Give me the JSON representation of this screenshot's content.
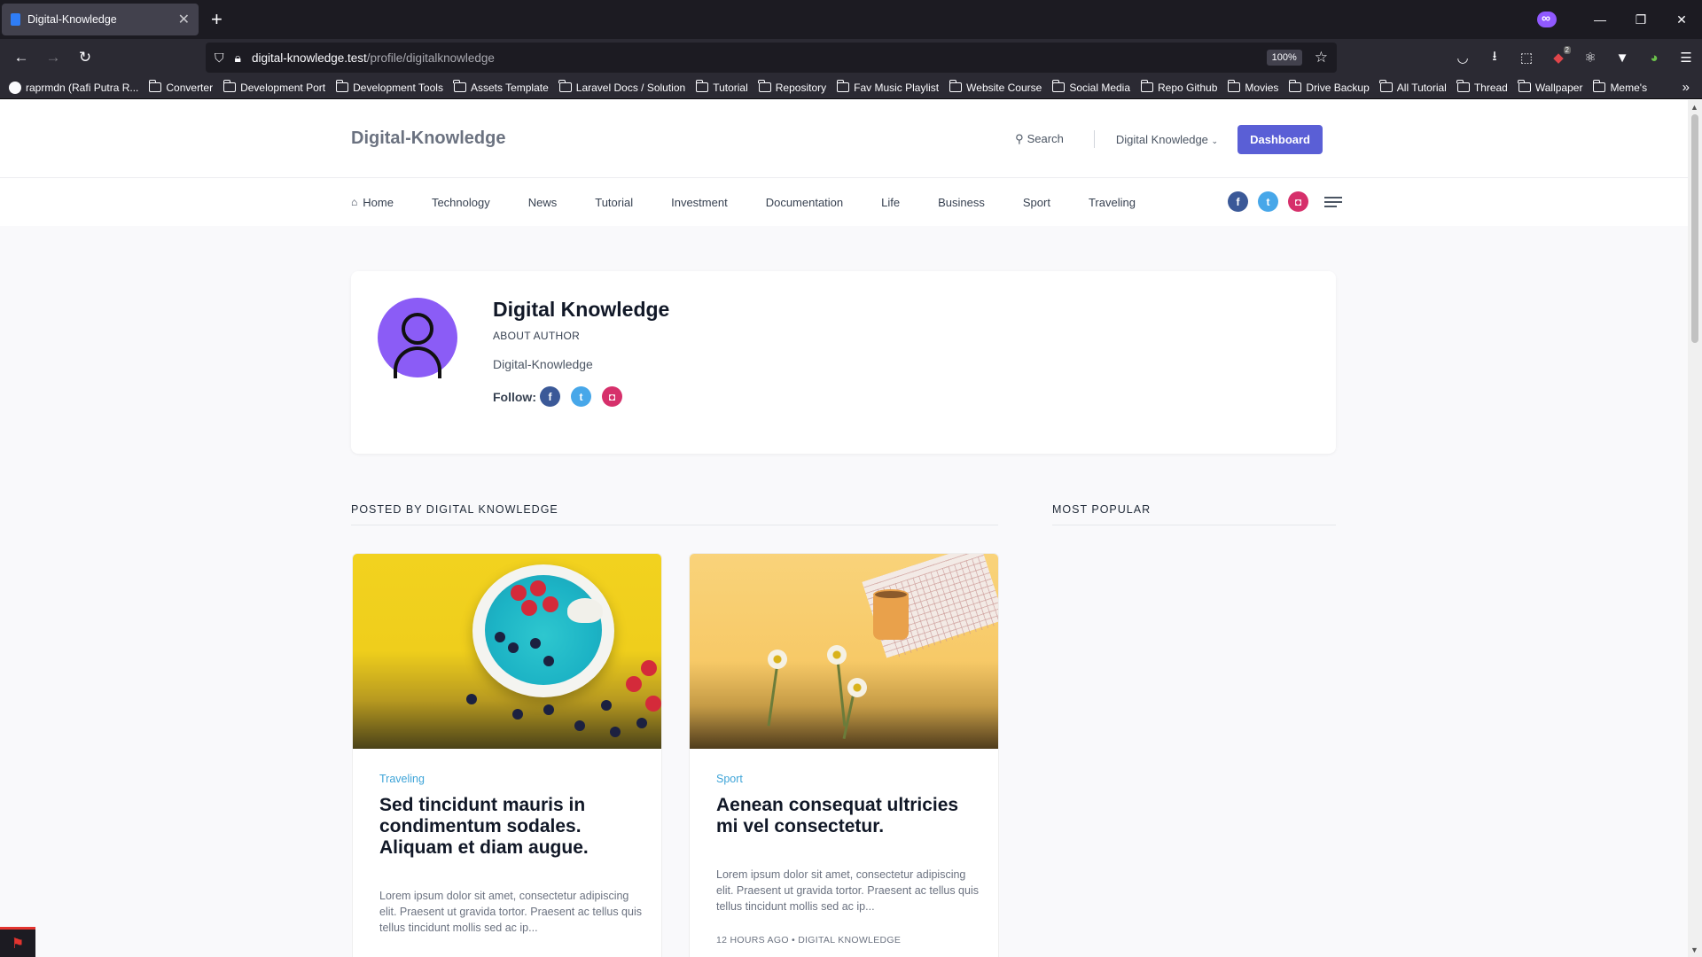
{
  "browser": {
    "tab_title": "Digital-Knowledge",
    "url_host": "digital-knowledge.test",
    "url_path": "/profile/digitalknowledge",
    "zoom": "100%",
    "extension_badge": "2",
    "bookmarks": [
      {
        "label": "raprmdn (Rafi Putra R...",
        "icon": "github-icon"
      },
      {
        "label": "Converter",
        "icon": "folder-icon"
      },
      {
        "label": "Development Port",
        "icon": "folder-icon"
      },
      {
        "label": "Development Tools",
        "icon": "folder-icon"
      },
      {
        "label": "Assets Template",
        "icon": "folder-icon"
      },
      {
        "label": "Laravel Docs / Solution",
        "icon": "folder-icon"
      },
      {
        "label": "Tutorial",
        "icon": "folder-icon"
      },
      {
        "label": "Repository",
        "icon": "folder-icon"
      },
      {
        "label": "Fav Music Playlist",
        "icon": "folder-icon"
      },
      {
        "label": "Website Course",
        "icon": "folder-icon"
      },
      {
        "label": "Social Media",
        "icon": "folder-icon"
      },
      {
        "label": "Repo Github",
        "icon": "folder-icon"
      },
      {
        "label": "Movies",
        "icon": "folder-icon"
      },
      {
        "label": "Drive Backup",
        "icon": "folder-icon"
      },
      {
        "label": "All Tutorial",
        "icon": "folder-icon"
      },
      {
        "label": "Thread",
        "icon": "folder-icon"
      },
      {
        "label": "Wallpaper",
        "icon": "folder-icon"
      },
      {
        "label": "Meme's",
        "icon": "folder-icon"
      }
    ]
  },
  "site": {
    "brand": "Digital-Knowledge",
    "search_label": "Search",
    "user_label": "Digital Knowledge",
    "dashboard_label": "Dashboard",
    "accent": "#5a5fd6",
    "menu": [
      "Home",
      "Technology",
      "News",
      "Tutorial",
      "Investment",
      "Documentation",
      "Life",
      "Business",
      "Sport",
      "Traveling"
    ]
  },
  "author": {
    "name": "Digital Knowledge",
    "role": "ABOUT AUTHOR",
    "bio": "Digital-Knowledge",
    "follow_label": "Follow:"
  },
  "sections": {
    "posted_by": "POSTED BY DIGITAL KNOWLEDGE",
    "most_popular": "MOST POPULAR"
  },
  "posts": [
    {
      "category": "Traveling",
      "title": "Sed tincidunt mauris in condimentum sodales. Aliquam et diam augue.",
      "excerpt": "Lorem ipsum dolor sit amet, consectetur adipiscing elit. Praesent ut gravida tortor. Praesent ac tellus quis tellus tincidunt mollis sed ac ip...",
      "meta": ""
    },
    {
      "category": "Sport",
      "title": "Aenean consequat ultricies mi vel consectetur.",
      "excerpt": "Lorem ipsum dolor sit amet, consectetur adipiscing elit. Praesent ut gravida tortor. Praesent ac tellus quis tellus tincidunt mollis sed ac ip...",
      "meta": "12 HOURS AGO  •  DIGITAL KNOWLEDGE"
    }
  ]
}
